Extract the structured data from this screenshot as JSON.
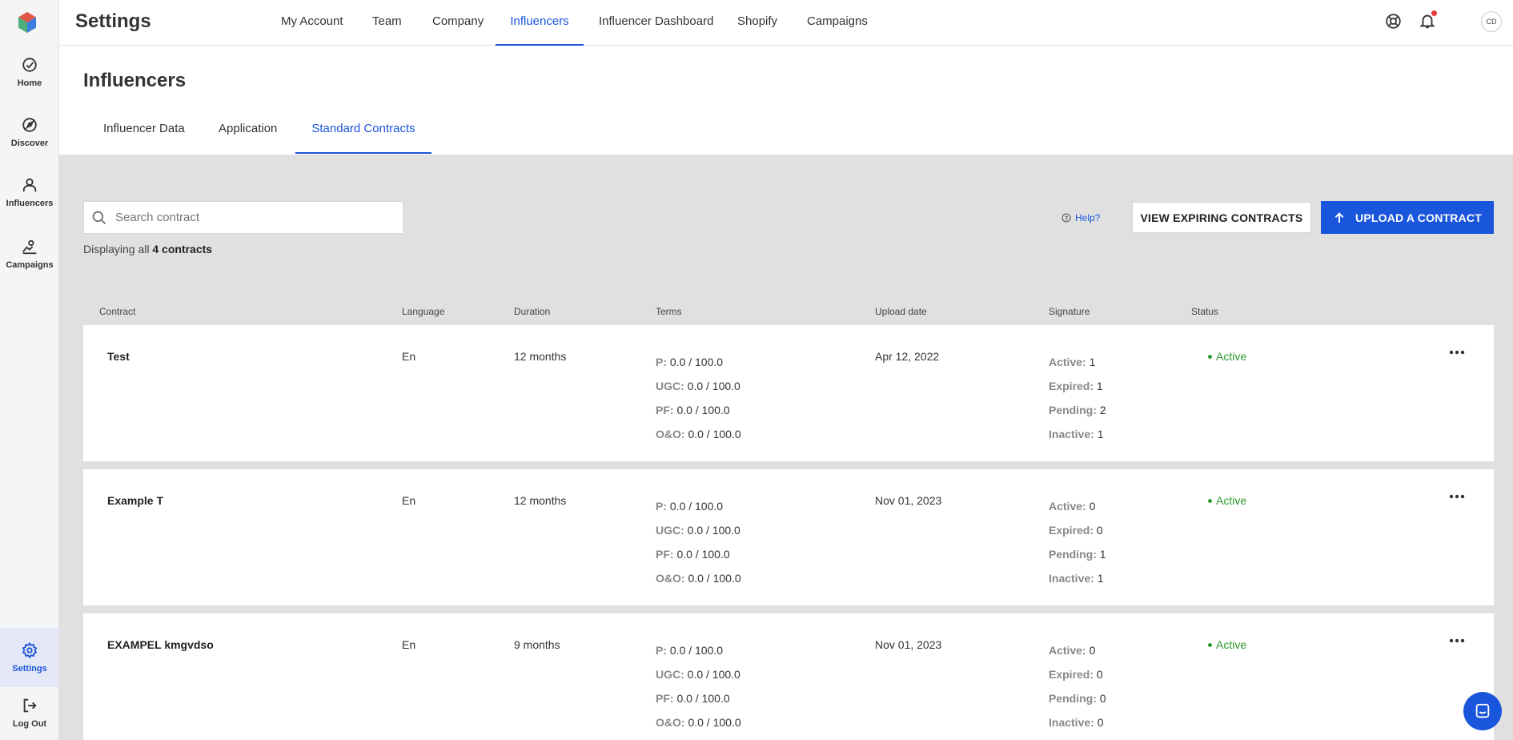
{
  "sidebar": {
    "items": [
      {
        "label": "Home",
        "icon": "home-icon"
      },
      {
        "label": "Discover",
        "icon": "discover-icon"
      },
      {
        "label": "Influencers",
        "icon": "influencers-icon"
      },
      {
        "label": "Campaigns",
        "icon": "campaigns-icon"
      }
    ],
    "settings_label": "Settings",
    "logout_label": "Log Out"
  },
  "header": {
    "title": "Settings",
    "tabs": [
      "My Account",
      "Team",
      "Company",
      "Influencers",
      "Influencer Dashboard",
      "Shopify",
      "Campaigns"
    ],
    "active_tab": "Influencers",
    "avatar_initials": "CD"
  },
  "page": {
    "title": "Influencers",
    "tabs": [
      "Influencer Data",
      "Application",
      "Standard Contracts"
    ],
    "active_tab": "Standard Contracts"
  },
  "toolbar": {
    "search_placeholder": "Search contract",
    "display_prefix": "Displaying all",
    "display_count": "4 contracts",
    "help_label": "Help?",
    "expiring_label": "VIEW EXPIRING CONTRACTS",
    "upload_label": "UPLOAD A CONTRACT"
  },
  "table": {
    "columns": [
      "Contract",
      "Language",
      "Duration",
      "Terms",
      "Upload date",
      "Signature",
      "Status"
    ],
    "term_keys": [
      "P:",
      "UGC:",
      "PF:",
      "O&O:"
    ],
    "signature_keys": [
      "Active:",
      "Expired:",
      "Pending:",
      "Inactive:"
    ],
    "rows": [
      {
        "name": "Test",
        "language": "En",
        "duration": "12 months",
        "terms": [
          "0.0 / 100.0",
          "0.0 / 100.0",
          "0.0 / 100.0",
          "0.0 / 100.0"
        ],
        "upload_date": "Apr 12, 2022",
        "signatures": [
          "1",
          "1",
          "2",
          "1"
        ],
        "status": "Active"
      },
      {
        "name": "Example T",
        "language": "En",
        "duration": "12 months",
        "terms": [
          "0.0 / 100.0",
          "0.0 / 100.0",
          "0.0 / 100.0",
          "0.0 / 100.0"
        ],
        "upload_date": "Nov 01, 2023",
        "signatures": [
          "0",
          "0",
          "1",
          "1"
        ],
        "status": "Active"
      },
      {
        "name": "EXAMPEL kmgvdso",
        "language": "En",
        "duration": "9 months",
        "terms": [
          "0.0 / 100.0",
          "0.0 / 100.0",
          "0.0 / 100.0",
          "0.0 / 100.0"
        ],
        "upload_date": "Nov 01, 2023",
        "signatures": [
          "0",
          "0",
          "0",
          "0"
        ],
        "status": "Active"
      }
    ]
  },
  "colors": {
    "accent": "#1a56db",
    "status_active": "#2e9a2e",
    "content_bg": "#e0e0e0"
  }
}
